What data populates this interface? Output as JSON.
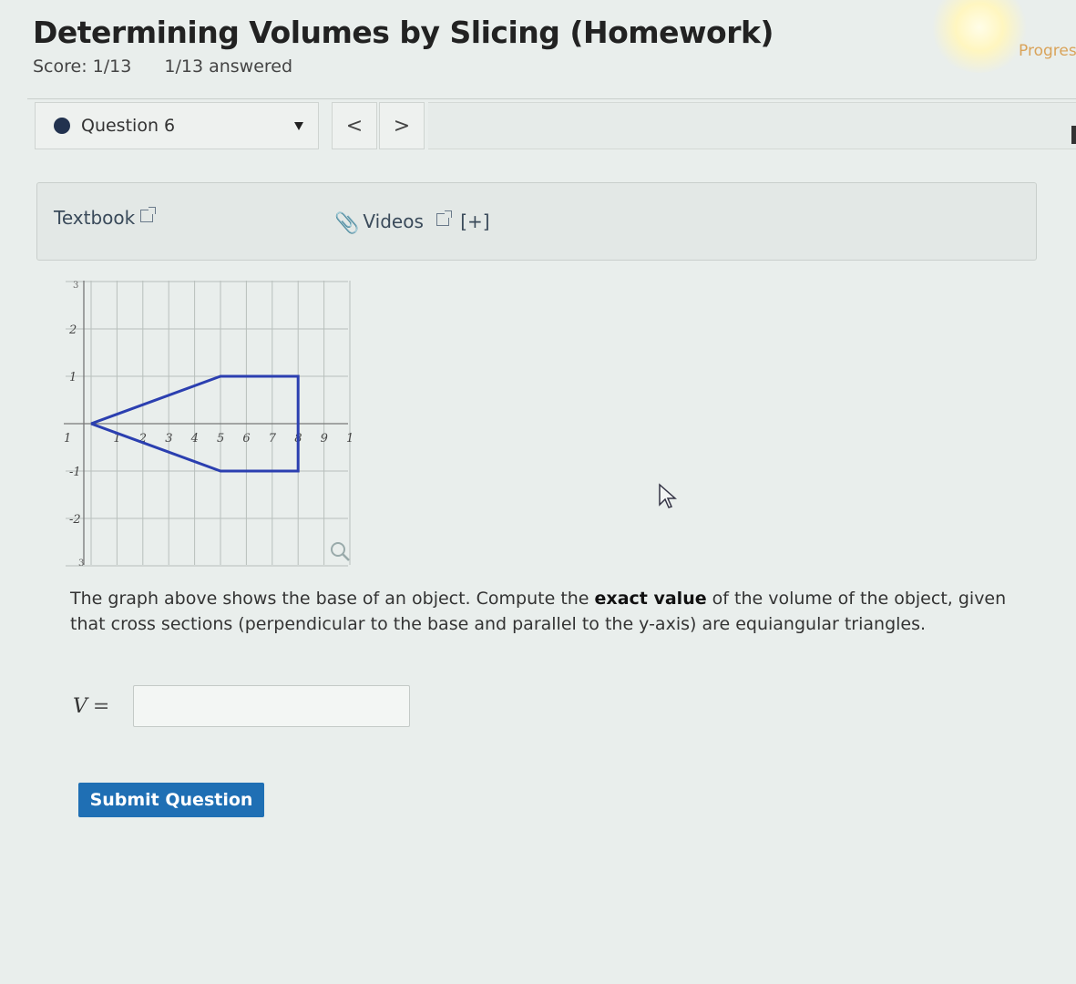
{
  "header": {
    "title": "Determining Volumes by Slicing (Homework)",
    "score": "Score: 1/13",
    "answered": "1/13 answered",
    "progress_label": "Progres"
  },
  "question_nav": {
    "selected": "Question 6",
    "prev_label": "<",
    "next_label": ">"
  },
  "resources": {
    "textbook_label": "Textbook",
    "videos_label": "Videos",
    "expand_label": "[+]"
  },
  "graph": {
    "x_ticks": [
      "1",
      "2",
      "3",
      "4",
      "5",
      "6",
      "7",
      "8",
      "9",
      "1"
    ],
    "y_ticks": [
      "2",
      "1",
      "-1",
      "-2"
    ],
    "left_axis_label": "1",
    "y_top_label": "3",
    "y_bottom_label": "3",
    "base_polygon": [
      [
        0,
        0
      ],
      [
        5,
        1
      ],
      [
        8,
        1
      ],
      [
        8,
        -1
      ],
      [
        5,
        -1
      ],
      [
        0,
        0
      ]
    ],
    "color": "#2b3fb0"
  },
  "question": {
    "text_before": "The graph above shows the base of an object. Compute the ",
    "bold": "exact value",
    "text_after": " of the volume of the object, given that cross sections (perpendicular to the base and parallel to the y-axis) are equiangular triangles."
  },
  "answer": {
    "variable": "V",
    "equals": "=",
    "value": ""
  },
  "submit_label": "Submit Question"
}
